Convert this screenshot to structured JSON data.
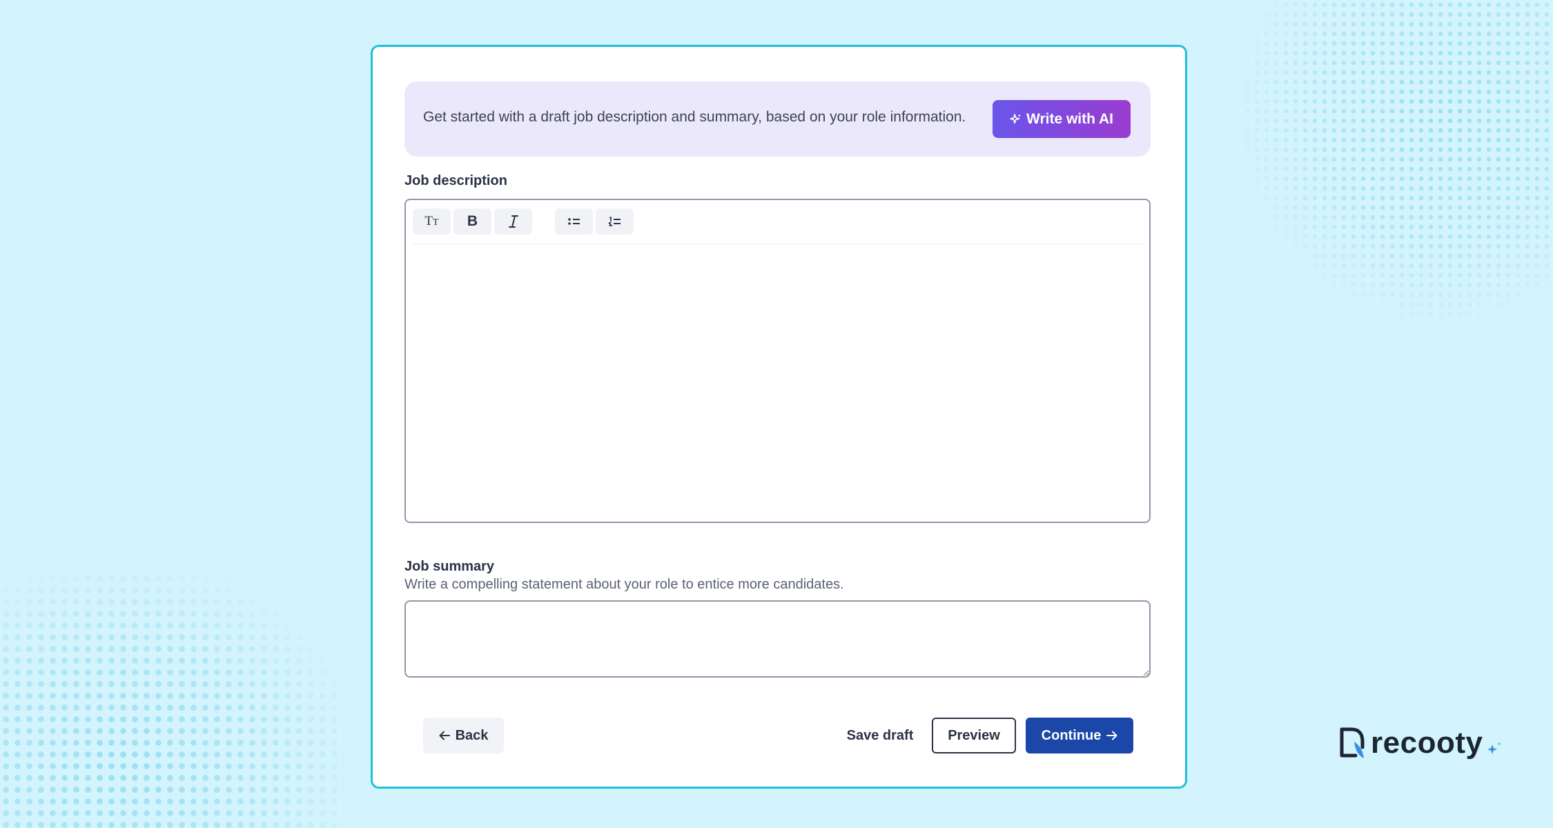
{
  "banner": {
    "text": "Get started with a draft job description and summary, based on your role information.",
    "ai_button_label": "Write with AI",
    "ai_button_icon": "sparkle-icon"
  },
  "job_description": {
    "label": "Job description",
    "toolbar": [
      {
        "name": "text-size",
        "icon": "text-size-icon",
        "glyph": "Tт"
      },
      {
        "name": "bold",
        "icon": "bold-icon",
        "glyph": "B"
      },
      {
        "name": "italic",
        "icon": "italic-icon",
        "glyph": "I"
      },
      {
        "name": "bullet-list",
        "icon": "bullet-list-icon"
      },
      {
        "name": "numbered-list",
        "icon": "numbered-list-icon"
      }
    ],
    "value": ""
  },
  "job_summary": {
    "label": "Job summary",
    "hint": "Write a compelling statement about your role to entice more candidates.",
    "value": ""
  },
  "footer": {
    "back_label": "Back",
    "save_draft_label": "Save draft",
    "preview_label": "Preview",
    "continue_label": "Continue"
  },
  "brand": {
    "name": "recooty"
  },
  "colors": {
    "background": "#d3f4fc",
    "card_border": "#1fbfe0",
    "banner_bg": "#ece8fb",
    "ai_gradient_start": "#6a55ea",
    "ai_gradient_end": "#9a3ccf",
    "primary": "#1a47a8",
    "text_dark": "#2b3246"
  }
}
